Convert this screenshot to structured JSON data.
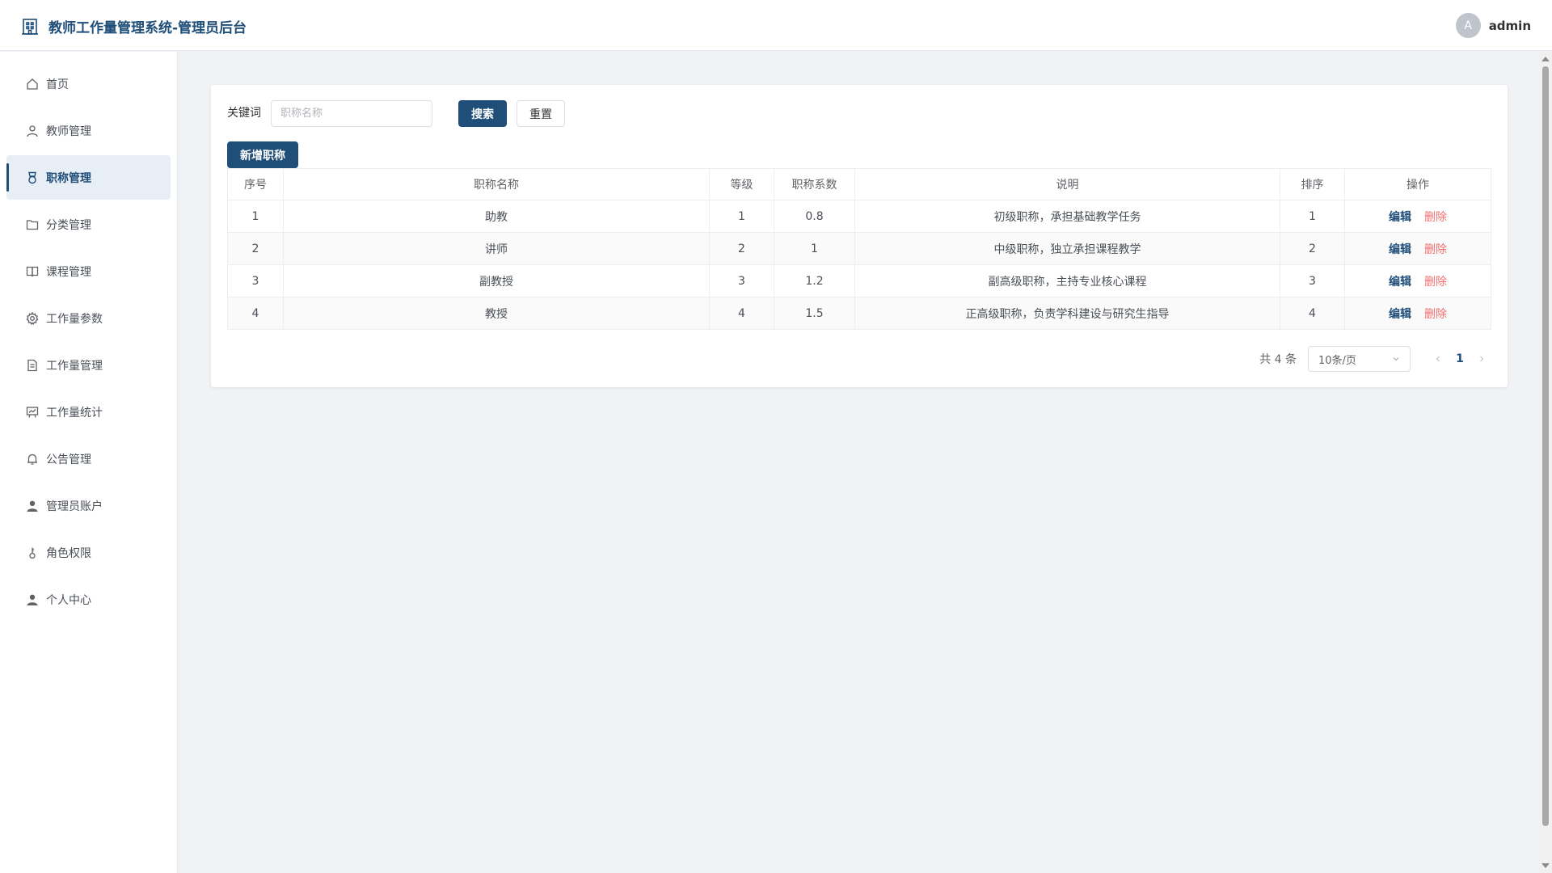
{
  "header": {
    "title": "教师工作量管理系统-管理员后台",
    "avatar_letter": "A",
    "username": "admin"
  },
  "sidebar": {
    "items": [
      {
        "label": "首页",
        "icon": "home-icon",
        "active": false
      },
      {
        "label": "教师管理",
        "icon": "user-icon",
        "active": false
      },
      {
        "label": "职称管理",
        "icon": "medal-icon",
        "active": true
      },
      {
        "label": "分类管理",
        "icon": "folder-icon",
        "active": false
      },
      {
        "label": "课程管理",
        "icon": "book-icon",
        "active": false
      },
      {
        "label": "工作量参数",
        "icon": "gear-icon",
        "active": false
      },
      {
        "label": "工作量管理",
        "icon": "document-icon",
        "active": false
      },
      {
        "label": "工作量统计",
        "icon": "chart-icon",
        "active": false
      },
      {
        "label": "公告管理",
        "icon": "bell-icon",
        "active": false
      },
      {
        "label": "管理员账户",
        "icon": "user-filled-icon",
        "active": false
      },
      {
        "label": "角色权限",
        "icon": "key-icon",
        "active": false
      },
      {
        "label": "个人中心",
        "icon": "user-filled-icon",
        "active": false
      }
    ]
  },
  "search": {
    "label": "关键词",
    "placeholder": "职称名称",
    "value": "",
    "search_button": "搜索",
    "reset_button": "重置"
  },
  "toolbar": {
    "add_button": "新增职称"
  },
  "table": {
    "headers": [
      "序号",
      "职称名称",
      "等级",
      "职称系数",
      "说明",
      "排序",
      "操作"
    ],
    "rows": [
      {
        "index": "1",
        "name": "助教",
        "level": "1",
        "coefficient": "0.8",
        "description": "初级职称，承担基础教学任务",
        "order": "1"
      },
      {
        "index": "2",
        "name": "讲师",
        "level": "2",
        "coefficient": "1",
        "description": "中级职称，独立承担课程教学",
        "order": "2"
      },
      {
        "index": "3",
        "name": "副教授",
        "level": "3",
        "coefficient": "1.2",
        "description": "副高级职称，主持专业核心课程",
        "order": "3"
      },
      {
        "index": "4",
        "name": "教授",
        "level": "4",
        "coefficient": "1.5",
        "description": "正高级职称，负责学科建设与研究生指导",
        "order": "4"
      }
    ],
    "edit_label": "编辑",
    "delete_label": "删除"
  },
  "pagination": {
    "total_text": "共 4 条",
    "page_size": "10条/页",
    "current_page": "1"
  },
  "colors": {
    "primary": "#1f4e79",
    "danger": "#f56c6c",
    "background": "#f0f2f5"
  }
}
